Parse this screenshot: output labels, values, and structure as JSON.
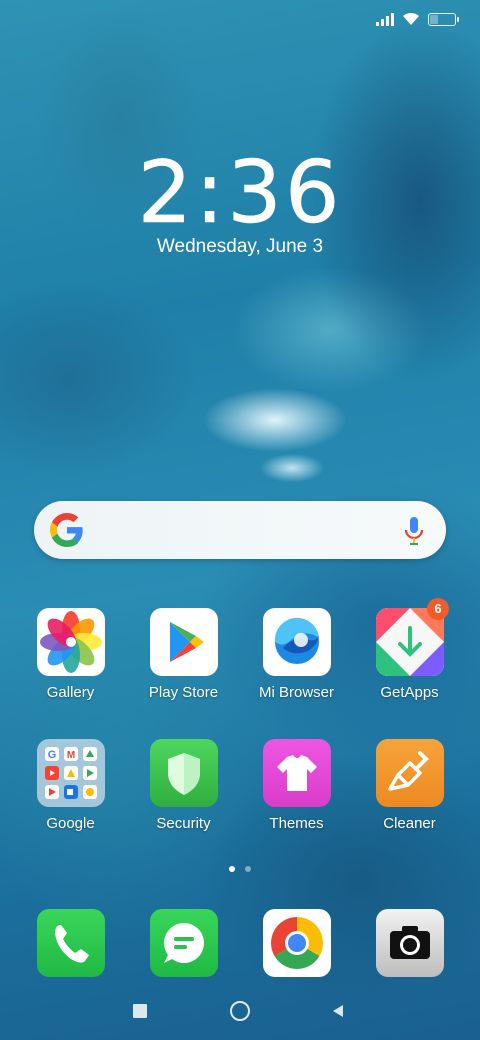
{
  "status_bar": {
    "signal_icon": "signal-icon",
    "wifi_icon": "wifi-icon",
    "battery_icon": "battery-icon",
    "battery_level": 0.3
  },
  "lock": {
    "time": "2:36",
    "date": "Wednesday, June 3"
  },
  "search_bar": {
    "logo_icon": "google-g-icon",
    "mic_icon": "microphone-icon"
  },
  "apps_row1": [
    {
      "label": "Gallery"
    },
    {
      "label": "Play Store"
    },
    {
      "label": "Mi Browser"
    },
    {
      "label": "GetApps",
      "badge": "6"
    }
  ],
  "apps_row2": [
    {
      "label": "Google"
    },
    {
      "label": "Security"
    },
    {
      "label": "Themes"
    },
    {
      "label": "Cleaner"
    }
  ],
  "dock": [
    {
      "icon": "phone-icon"
    },
    {
      "icon": "messages-icon"
    },
    {
      "icon": "chrome-icon"
    },
    {
      "icon": "camera-icon"
    }
  ],
  "page_indicator": {
    "pages": 2,
    "current": 1
  },
  "nav_bar": {
    "recents_icon": "recents-square-icon",
    "home_icon": "home-circle-icon",
    "back_icon": "back-triangle-icon"
  },
  "colors": {
    "badge": "#f25a28",
    "security_green": "#39c24b",
    "themes_pink": "#e64ad8",
    "cleaner_orange": "#f2952a"
  }
}
